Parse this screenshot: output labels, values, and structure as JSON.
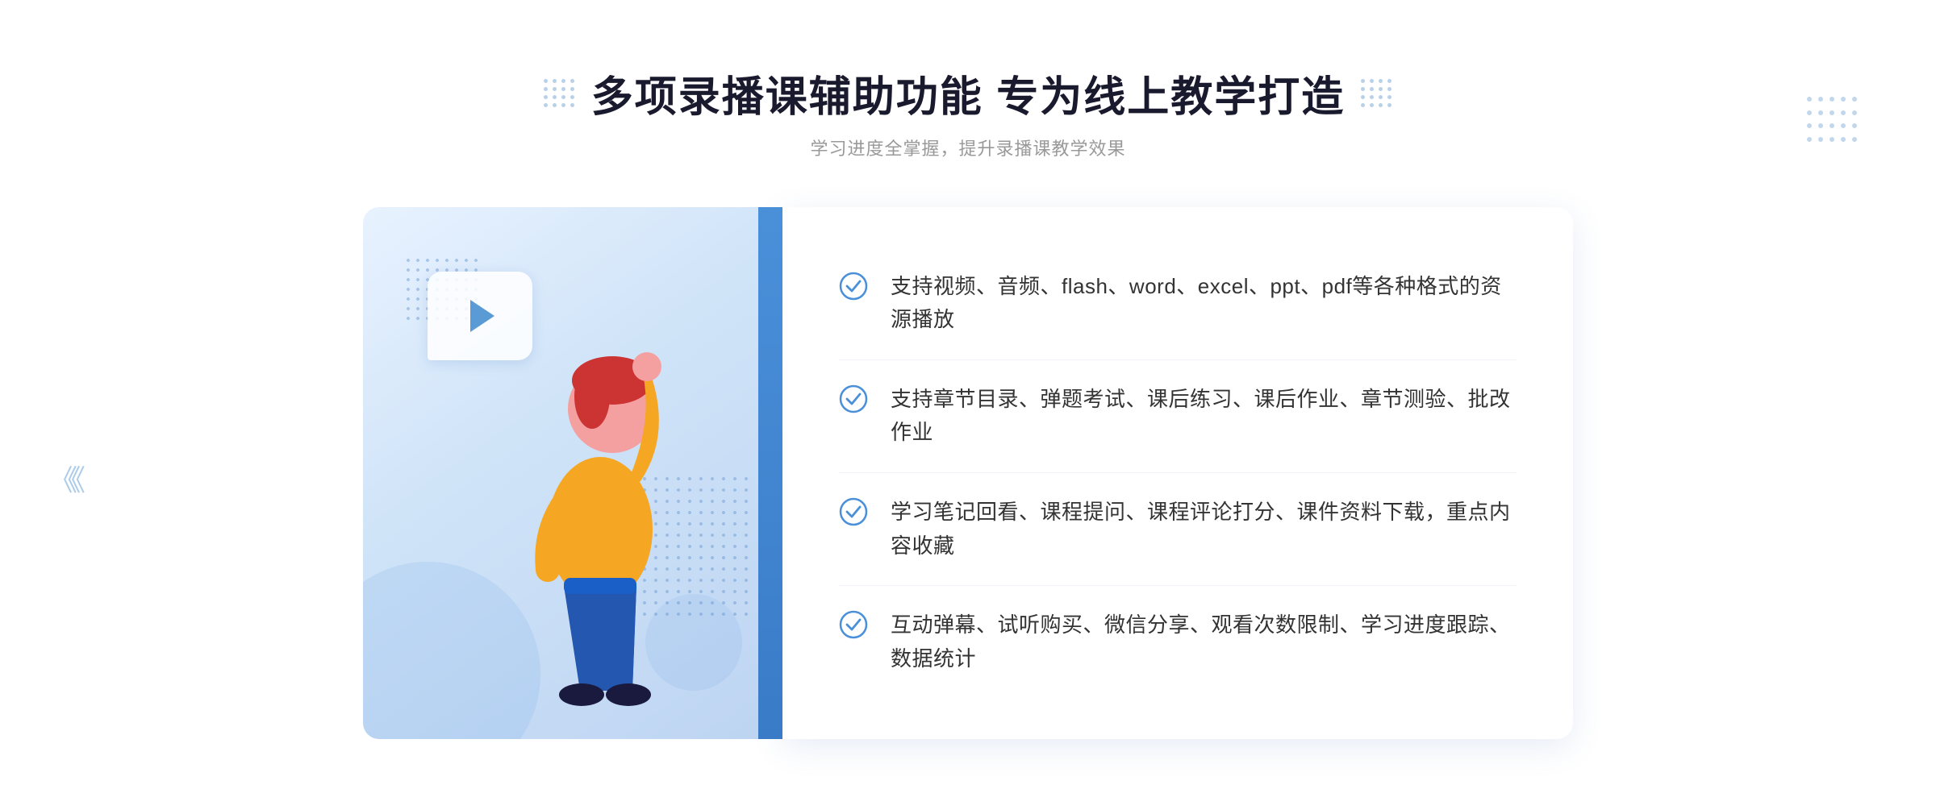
{
  "header": {
    "main_title": "多项录播课辅助功能 专为线上教学打造",
    "sub_title": "学习进度全掌握，提升录播课教学效果"
  },
  "features": [
    {
      "id": 1,
      "text": "支持视频、音频、flash、word、excel、ppt、pdf等各种格式的资源播放"
    },
    {
      "id": 2,
      "text": "支持章节目录、弹题考试、课后练习、课后作业、章节测验、批改作业"
    },
    {
      "id": 3,
      "text": "学习笔记回看、课程提问、课程评论打分、课件资料下载，重点内容收藏"
    },
    {
      "id": 4,
      "text": "互动弹幕、试听购买、微信分享、观看次数限制、学习进度跟踪、数据统计"
    }
  ],
  "colors": {
    "primary_blue": "#4a90d9",
    "light_blue": "#d0e4f8",
    "check_blue": "#4a90d9",
    "title_color": "#1a1a2e",
    "text_color": "#333333",
    "sub_color": "#999999"
  }
}
